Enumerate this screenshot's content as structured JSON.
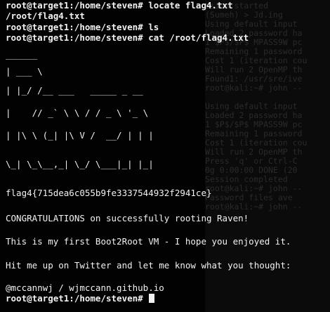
{
  "terminal": {
    "background_color": "#020202",
    "text_color": "#f2f2f2",
    "lines": [
      "root@target1:/home/steven# locate flag4.txt",
      "/root/flag4.txt",
      "root@target1:/home/steven# ls",
      "root@target1:/home/steven# cat /root/flag4.txt",
      "______",
      "| ___ \\",
      "| |_/ /__ ___   _____ _ __",
      "|    // _` \\ \\ / / _ \\ '_ \\",
      "| |\\ \\ (_| |\\ V /  __/ | | |",
      "\\_| \\_\\__,_| \\_/ \\___|_| |_|",
      "flag4{715dea6c055b9fe3337544932f2941ce}",
      "CONGRATULATIONS on successfully rooting Raven!",
      "This is my first Boot2Root VM - I hope you enjoyed it.",
      "Hit me up on Twitter and let me know what you thought:",
      "@mccannwj / wjmccann.github.io",
      "root@target1:/home/steven# "
    ]
  },
  "background_terminal": {
    "lines": [
      "ssion.started",
      "(Sumeh) > Jd.ing",
      "Using default input",
      "Loaded 2 password ha",
      "1 $P$/$P$ MPASS9W pc",
      "Remaining 1 password",
      "Cost 1 (iteration cou",
      "Will run 2 OpenMP th",
      "Found1: /usr/sre/ive",
      "root@kali:~# john --",
      "",
      "Using default input",
      "Loaded 2 password ha",
      "1 $P$/$P$ MPASS9W pc",
      "Remaining 1 password",
      "Cost 1 (iteration cou",
      "Will run 2 OpenMP th",
      "Press 'q' or Ctrl-C",
      "0g 0:00:00 DONE (20",
      "Session completed",
      "root@kali:~# john --",
      "Password files ave",
      "root@kali:~# john --",
      "",
      "",
      "",
      "",
      "",
      "",
      "",
      "",
      "",
      ""
    ]
  }
}
